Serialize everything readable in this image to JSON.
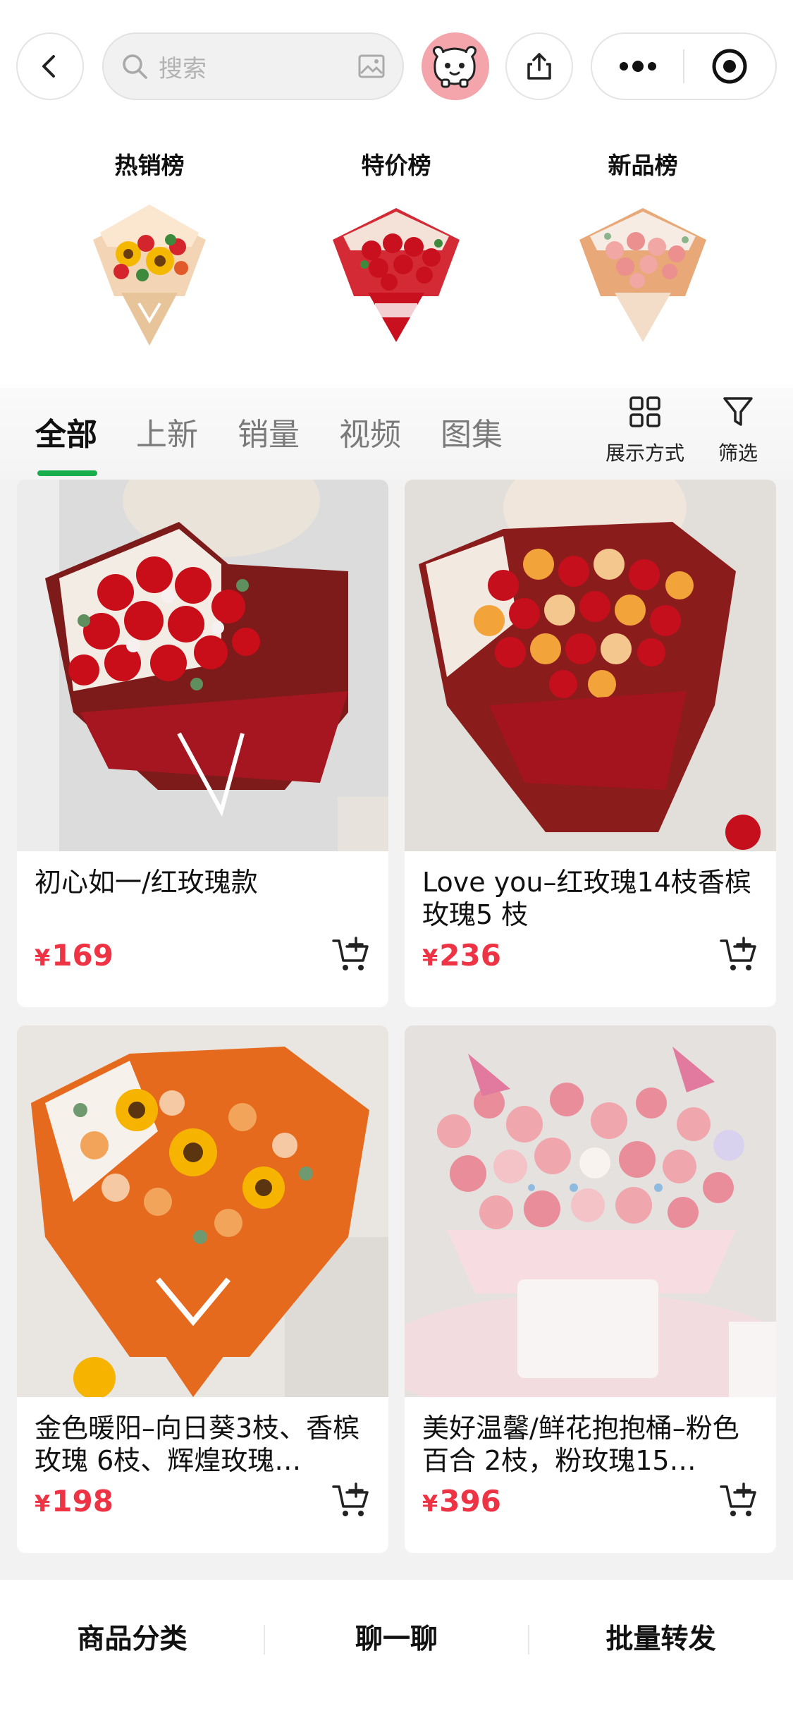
{
  "header": {
    "search_placeholder": "搜索"
  },
  "rankings": [
    {
      "title": "热销榜"
    },
    {
      "title": "特价榜"
    },
    {
      "title": "新品榜"
    }
  ],
  "tabs": [
    {
      "label": "全部",
      "active": true
    },
    {
      "label": "上新",
      "active": false
    },
    {
      "label": "销量",
      "active": false
    },
    {
      "label": "视频",
      "active": false
    },
    {
      "label": "图集",
      "active": false
    }
  ],
  "tools": {
    "display_mode": "展示方式",
    "filter": "筛选"
  },
  "products": [
    {
      "name": "初心如一/红玫瑰款",
      "currency": "¥",
      "price": "169"
    },
    {
      "name": "Love you–红玫瑰14枝香槟玫瑰5 枝",
      "currency": "¥",
      "price": "236"
    },
    {
      "name": "金色暖阳–向日葵3枝、香槟玫瑰 6枝、辉煌玫瑰…",
      "currency": "¥",
      "price": "198"
    },
    {
      "name": "美好温馨/鲜花抱抱桶–粉色百合 2枝，粉玫瑰15…",
      "currency": "¥",
      "price": "396"
    }
  ],
  "bottom_bar": {
    "category": "商品分类",
    "chat": "聊一聊",
    "bulk_forward": "批量转发"
  },
  "colors": {
    "accent_green": "#1aad4b",
    "price_red": "#ee3344"
  }
}
